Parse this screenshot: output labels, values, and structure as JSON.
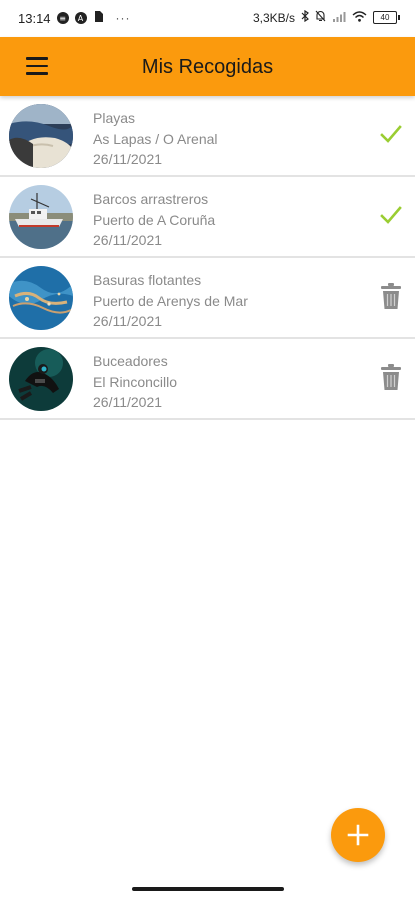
{
  "status_bar": {
    "time": "13:14",
    "network_speed": "3,3KB/s",
    "battery_level": "40",
    "more_dots": "···"
  },
  "app_bar": {
    "title": "Mis Recogidas",
    "background_color": "#fb9a0d"
  },
  "items": [
    {
      "category": "Playas",
      "location": "As Lapas / O Arenal",
      "date": "26/11/2021",
      "status": "check-icon",
      "thumbnail": "beach-photo"
    },
    {
      "category": "Barcos arrastreros",
      "location": "Puerto de A Coruña",
      "date": "26/11/2021",
      "status": "check-icon",
      "thumbnail": "trawler-photo"
    },
    {
      "category": "Basuras flotantes",
      "location": "Puerto de Arenys de Mar",
      "date": "26/11/2021",
      "status": "trash-icon",
      "thumbnail": "floating-trash-photo"
    },
    {
      "category": "Buceadores",
      "location": "El Rinconcillo",
      "date": "26/11/2021",
      "status": "trash-icon",
      "thumbnail": "diver-photo"
    }
  ],
  "colors": {
    "accent": "#fb9a0d",
    "check": "#9acd32",
    "trash": "#8c8c8c",
    "secondary_text": "#8a8a8a"
  },
  "fab": {
    "icon": "plus-icon"
  }
}
